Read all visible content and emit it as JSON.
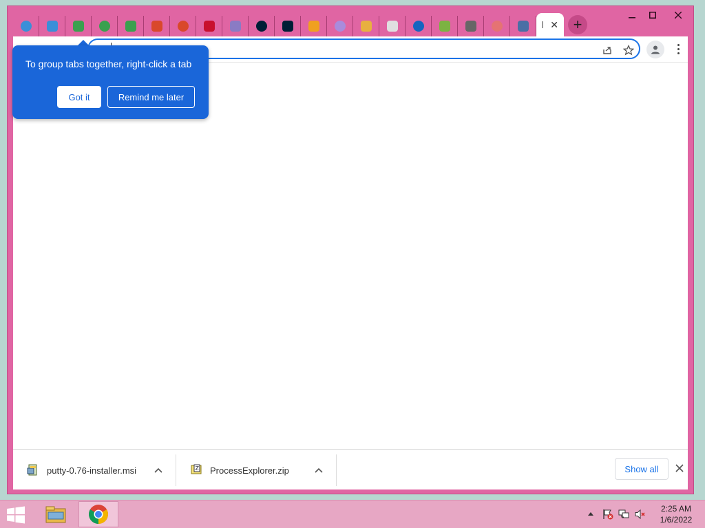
{
  "colors": {
    "window_frame": "#e065a3",
    "accent_blue": "#1a66d9",
    "taskbar": "#e7a7c4"
  },
  "window": {
    "minimize_icon": "minimize-icon",
    "maximize_icon": "maximize-icon",
    "close_icon": "close-icon"
  },
  "tabs": [
    {
      "icon": "favicon-1",
      "color": "#3a8fd8"
    },
    {
      "icon": "favicon-2",
      "color": "#3a8fd8"
    },
    {
      "icon": "favicon-3",
      "color": "#3aa04f"
    },
    {
      "icon": "favicon-4",
      "color": "#3aa04f"
    },
    {
      "icon": "favicon-5",
      "color": "#3aa04f"
    },
    {
      "icon": "favicon-6",
      "color": "#d9482b"
    },
    {
      "icon": "favicon-7",
      "color": "#d9482b"
    },
    {
      "icon": "favicon-8",
      "color": "#c8102e"
    },
    {
      "icon": "favicon-9",
      "color": "#8a7bc4"
    },
    {
      "icon": "favicon-10",
      "color": "#001e36"
    },
    {
      "icon": "favicon-11",
      "color": "#001e36"
    },
    {
      "icon": "favicon-12",
      "color": "#f0a020"
    },
    {
      "icon": "favicon-13",
      "color": "#a98bdc"
    },
    {
      "icon": "favicon-14",
      "color": "#e8b040"
    },
    {
      "icon": "favicon-15",
      "color": "#e0e0e0"
    },
    {
      "icon": "favicon-16",
      "color": "#1565c0"
    },
    {
      "icon": "favicon-17",
      "color": "#7cb342"
    },
    {
      "icon": "favicon-18",
      "color": "#666666"
    },
    {
      "icon": "favicon-19",
      "color": "#e57373"
    },
    {
      "icon": "favicon-20",
      "color": "#4a6fa5"
    }
  ],
  "active_tab": {
    "close_label": "✕"
  },
  "new_tab_label": "+",
  "tooltip": {
    "text": "To group tabs together, right-click a tab",
    "got_it": "Got it",
    "remind_later": "Remind me later"
  },
  "downloads": {
    "items": [
      {
        "name": "putty-0.76-installer.msi",
        "icon": "msi-file-icon"
      },
      {
        "name": "ProcessExplorer.zip",
        "icon": "zip-file-icon"
      }
    ],
    "show_all": "Show all"
  },
  "taskbar": {
    "time": "2:25 AM",
    "date": "1/6/2022"
  }
}
